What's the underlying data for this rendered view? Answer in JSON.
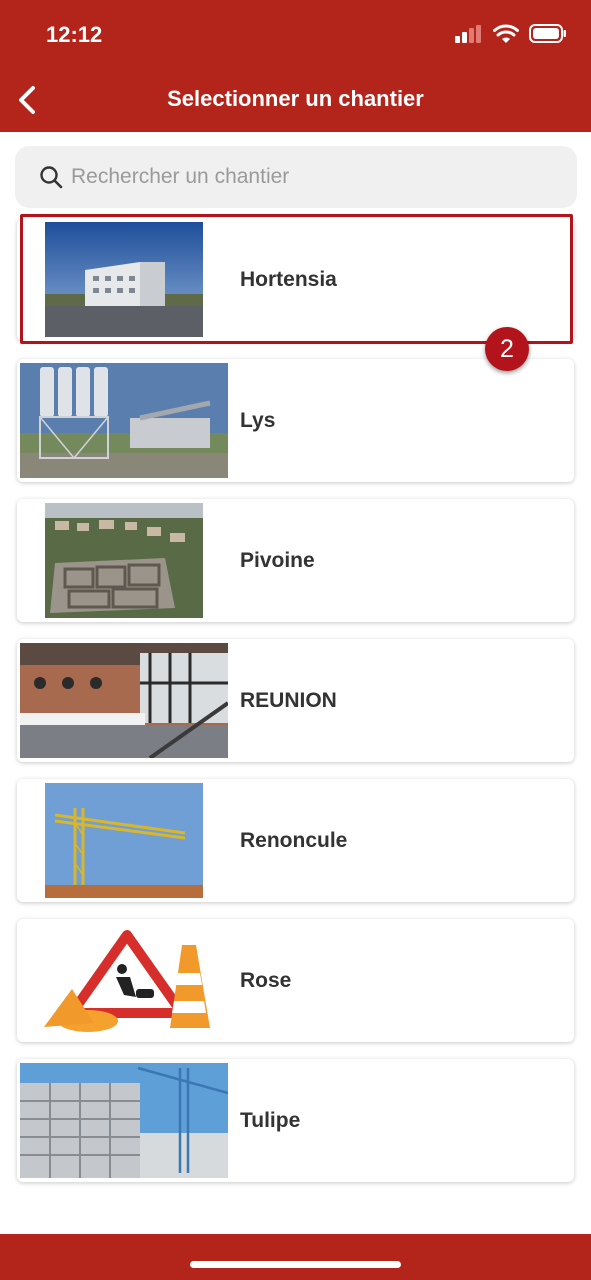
{
  "status_bar": {
    "time": "12:12"
  },
  "header": {
    "title": "Selectionner un chantier",
    "back_icon": "chevron-left-icon"
  },
  "search": {
    "placeholder": "Rechercher un chantier",
    "value": ""
  },
  "chantiers": [
    {
      "name": "Hortensia"
    },
    {
      "name": "Lys"
    },
    {
      "name": "Pivoine"
    },
    {
      "name": "REUNION"
    },
    {
      "name": "Renoncule"
    },
    {
      "name": "Rose"
    },
    {
      "name": "Tulipe"
    }
  ],
  "callout": {
    "number": "2"
  },
  "colors": {
    "brand": "#b3241b",
    "highlight": "#b3141b"
  }
}
